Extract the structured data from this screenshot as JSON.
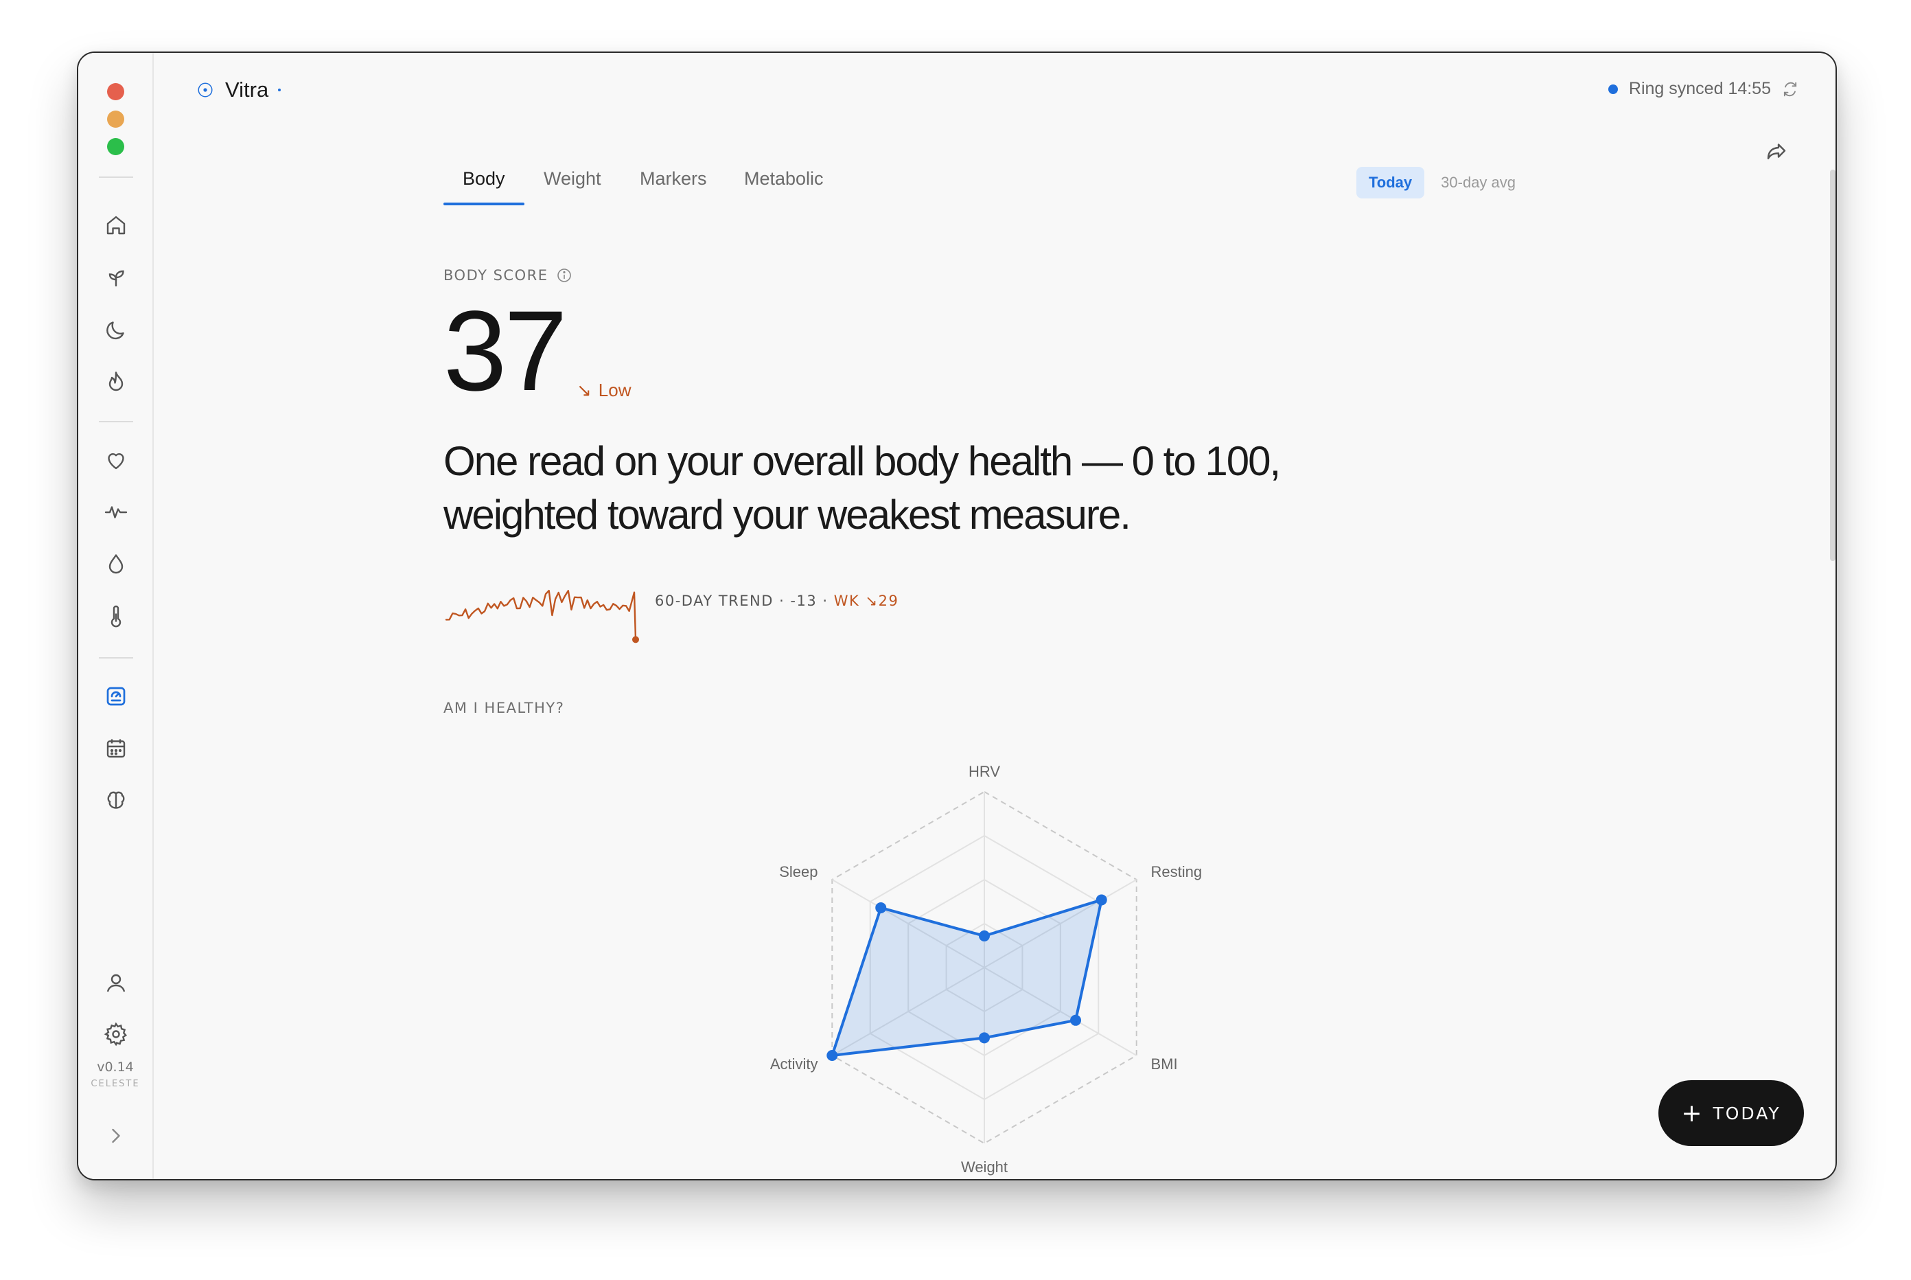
{
  "app": {
    "title": "Vitra"
  },
  "window_controls": [
    {
      "name": "close",
      "color": "#e5604d"
    },
    {
      "name": "minimize",
      "color": "#e9a652"
    },
    {
      "name": "maximize",
      "color": "#2bbe4a"
    }
  ],
  "sidebar": {
    "nav_icons": [
      "home-icon",
      "sprout-icon",
      "moon-icon",
      "flame-icon",
      "heart-icon",
      "pulse-icon",
      "drop-icon",
      "thermometer-icon",
      "scale-icon",
      "calendar-icon",
      "brain-icon"
    ],
    "active_icon": "scale-icon",
    "bottom_icons": [
      "user-icon",
      "gear-icon",
      "chevron-right-icon"
    ],
    "version": "v0.14",
    "codename": "CELESTE"
  },
  "sync": {
    "text": "Ring synced 14:55",
    "icon": "refresh-icon",
    "color": "#1f6fdc"
  },
  "share_icon": "share-icon",
  "tabs": [
    {
      "label": "Body",
      "active": true
    },
    {
      "label": "Weight",
      "active": false
    },
    {
      "label": "Markers",
      "active": false
    },
    {
      "label": "Metabolic",
      "active": false
    }
  ],
  "range": {
    "today": "Today",
    "avg": "30-day avg",
    "selected": "Today"
  },
  "score": {
    "label": "BODY SCORE",
    "value": "37",
    "status": "Low",
    "status_arrow": "↘",
    "status_color": "#c05621"
  },
  "headline": "One read on your overall body health — 0 to 100, weighted toward your weakest measure.",
  "trend": {
    "label": "60-DAY TREND · -13 ·",
    "wk": "WK ↘29",
    "color": "#c05621"
  },
  "healthy": {
    "label": "AM I HEALTHY?",
    "chart_data": {
      "type": "radar",
      "axes": [
        "HRV",
        "Resting HR",
        "BMI",
        "Weight",
        "Activity",
        "Sleep"
      ],
      "values": [
        18,
        77,
        60,
        40,
        100,
        68
      ],
      "range": [
        0,
        100
      ],
      "rings": 4,
      "series_color": "#1f6fdc"
    }
  },
  "fab": {
    "label": "TODAY"
  }
}
